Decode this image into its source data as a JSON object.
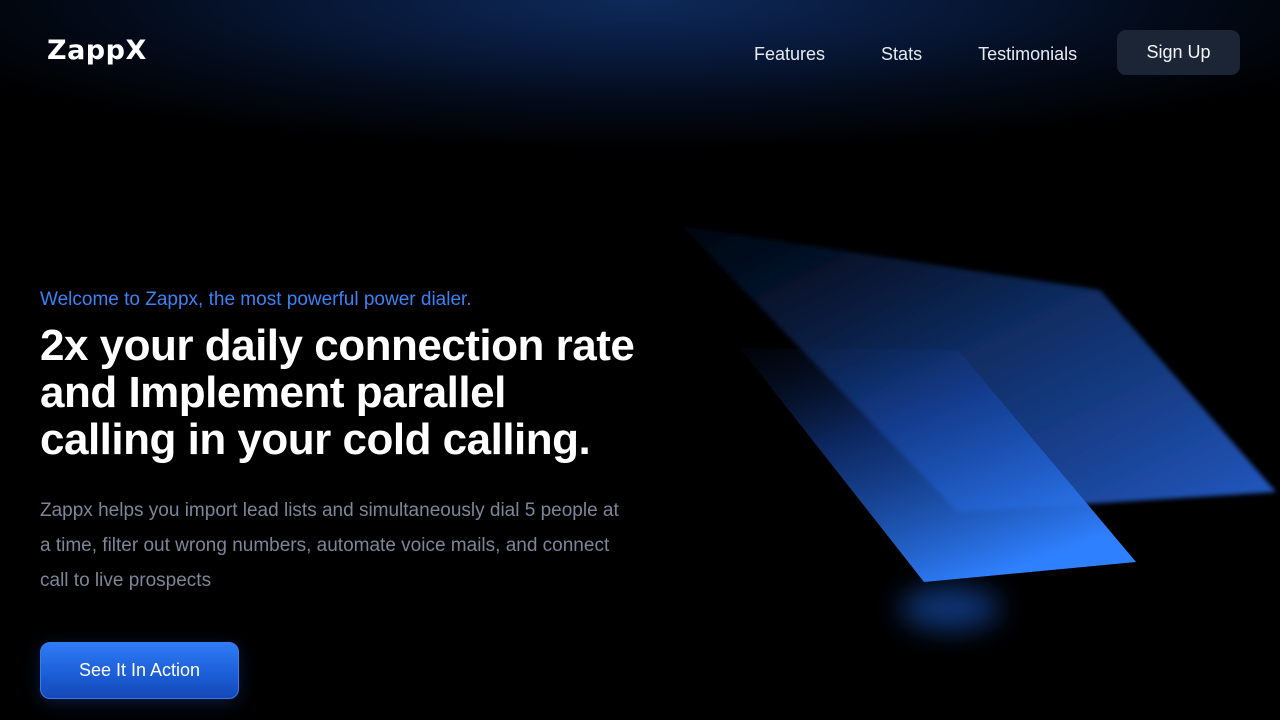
{
  "brand": {
    "logo_text": "ZappX"
  },
  "nav": {
    "links": [
      {
        "label": "Features"
      },
      {
        "label": "Stats"
      },
      {
        "label": "Testimonials"
      }
    ],
    "signup_label": "Sign Up"
  },
  "hero": {
    "eyebrow": "Welcome to Zappx, the most powerful power dialer.",
    "headline_lines": [
      "2x your daily connection rate",
      "and Implement parallel",
      "calling in your cold calling."
    ],
    "description": "Zappx helps you import lead lists and simultaneously dial 5 people at a time, filter out wrong numbers, automate voice mails, and connect call to live prospects",
    "cta_label": "See It In Action"
  },
  "colors": {
    "accent": "#3b82f6",
    "cta": "#1c5fd8",
    "background": "#000000",
    "nav_button": "#1b2536",
    "muted_text": "#7c8699"
  }
}
